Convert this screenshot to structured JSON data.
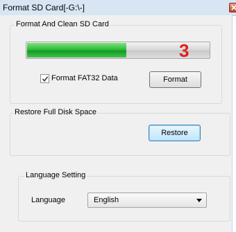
{
  "window": {
    "title": "Format SD Card[-G:\\-]"
  },
  "format_group": {
    "legend": "Format And Clean SD Card",
    "progress": 0.55,
    "step_number": "3",
    "checkbox_label": "Format FAT32 Data",
    "checkbox_checked": true,
    "format_button": "Format"
  },
  "restore_group": {
    "legend": "Restore Full Disk Space",
    "restore_button": "Restore"
  },
  "language_group": {
    "legend": "Language Setting",
    "label": "Language",
    "selected": "English"
  }
}
